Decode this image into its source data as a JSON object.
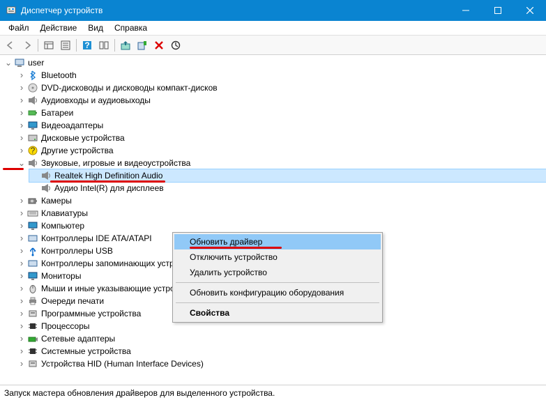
{
  "window": {
    "title": "Диспетчер устройств"
  },
  "menu": {
    "file": "Файл",
    "action": "Действие",
    "view": "Вид",
    "help": "Справка"
  },
  "tree": {
    "root": "user",
    "items": [
      "Bluetooth",
      "DVD-дисководы и дисководы компакт-дисков",
      "Аудиовходы и аудиовыходы",
      "Батареи",
      "Видеоадаптеры",
      "Дисковые устройства",
      "Другие устройства",
      "Звуковые, игровые и видеоустройства",
      "Камеры",
      "Клавиатуры",
      "Компьютер",
      "Контроллеры IDE ATA/ATAPI",
      "Контроллеры USB",
      "Контроллеры запоминающих устройств",
      "Мониторы",
      "Мыши и иные указывающие устройства",
      "Очереди печати",
      "Программные устройства",
      "Процессоры",
      "Сетевые адаптеры",
      "Системные устройства",
      "Устройства HID (Human Interface Devices)"
    ],
    "sound_children": [
      "Realtek High Definition Audio",
      "Аудио Intel(R) для дисплеев"
    ]
  },
  "context": {
    "update": "Обновить драйвер",
    "disable": "Отключить устройство",
    "remove": "Удалить устройство",
    "scan": "Обновить конфигурацию оборудования",
    "props": "Свойства"
  },
  "status": "Запуск мастера обновления драйверов для выделенного устройства."
}
